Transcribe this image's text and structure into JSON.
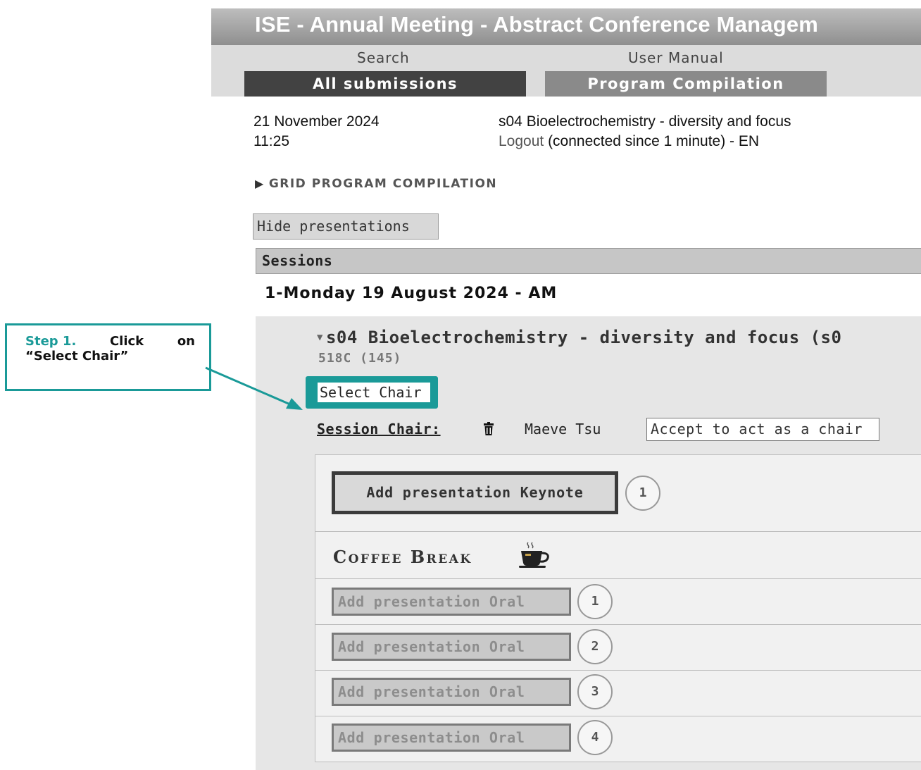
{
  "header": {
    "title": "ISE - Annual Meeting - Abstract Conference Managem",
    "nav": {
      "search": "Search",
      "user_manual": "User Manual"
    },
    "tabs": [
      {
        "label": "All submissions",
        "active": true
      },
      {
        "label": "Program Compilation",
        "active": false
      }
    ]
  },
  "info": {
    "date": "21 November 2024",
    "time": "11:25",
    "session": "s04 Bioelectrochemistry - diversity and focus",
    "logout": "Logout",
    "connection": " (connected since 1 minute) - EN"
  },
  "grid": {
    "heading": "GRID PROGRAM COMPILATION",
    "hide_button": "Hide presentations",
    "sessions_header": "Sessions",
    "day": "1-Monday 19 August 2024 - AM"
  },
  "session": {
    "title": "s04 Bioelectrochemistry - diversity and focus (s0",
    "room": "518C (145)",
    "select_chair": "Select Chair",
    "chair_label": "Session Chair:",
    "chair_name": "Maeve Tsu",
    "accept_button": "Accept to act as a chair",
    "keynote": {
      "label": "Add presentation Keynote",
      "number": "1"
    },
    "coffee_break": "Coffee Break",
    "orals": [
      {
        "label": "Add presentation Oral",
        "number": "1"
      },
      {
        "label": "Add presentation Oral",
        "number": "2"
      },
      {
        "label": "Add presentation Oral",
        "number": "3"
      },
      {
        "label": "Add presentation Oral",
        "number": "4"
      }
    ]
  },
  "annotation": {
    "step_number": "Step 1.",
    "step_word_click": "Click",
    "step_word_on": "on",
    "step_target": "“Select Chair”"
  },
  "colors": {
    "accent_teal": "#1a9a98",
    "tab_active": "#424242",
    "tab_inactive": "#8a8a8a"
  },
  "icons": [
    "trash-icon",
    "coffee-cup-icon",
    "chevron-down-icon",
    "triangle-right-icon",
    "arrow-icon"
  ]
}
